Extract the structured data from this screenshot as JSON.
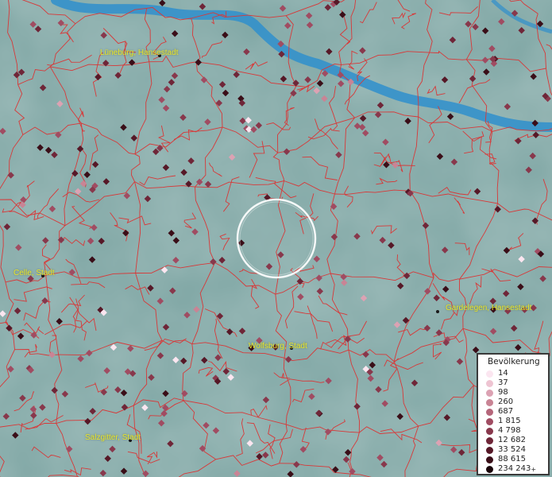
{
  "map": {
    "cities": [
      {
        "name": "Lüneburg, Hansestadt",
        "key": "lueneburg"
      },
      {
        "name": "Celle, Stadt",
        "key": "celle"
      },
      {
        "name": "Gardelegen, Hansestadt",
        "key": "gardelegen"
      },
      {
        "name": "Wolfsburg, Stadt",
        "key": "wolfsburg"
      },
      {
        "name": "Salzgitter, Stadt",
        "key": "salzgitter"
      }
    ],
    "colors": {
      "background": "#7fa6a4",
      "river": "#2f8fcc",
      "boundary": "#d83838",
      "label": "#e8e62a"
    }
  },
  "legend": {
    "title": "Bevölkerung",
    "entries": [
      {
        "label": "14",
        "color": "#fbe6f0"
      },
      {
        "label": "37",
        "color": "#eec4d2"
      },
      {
        "label": "98",
        "color": "#dca2b3"
      },
      {
        "label": "260",
        "color": "#c98495"
      },
      {
        "label": "687",
        "color": "#b5667a"
      },
      {
        "label": "1 815",
        "color": "#a04c62"
      },
      {
        "label": "4 798",
        "color": "#88384c"
      },
      {
        "label": "12 682",
        "color": "#6f2638"
      },
      {
        "label": "33 524",
        "color": "#561827"
      },
      {
        "label": "88 615",
        "color": "#3a0e18"
      },
      {
        "label": "234 243",
        "color": "#1a050a",
        "suffix": "+"
      }
    ]
  }
}
